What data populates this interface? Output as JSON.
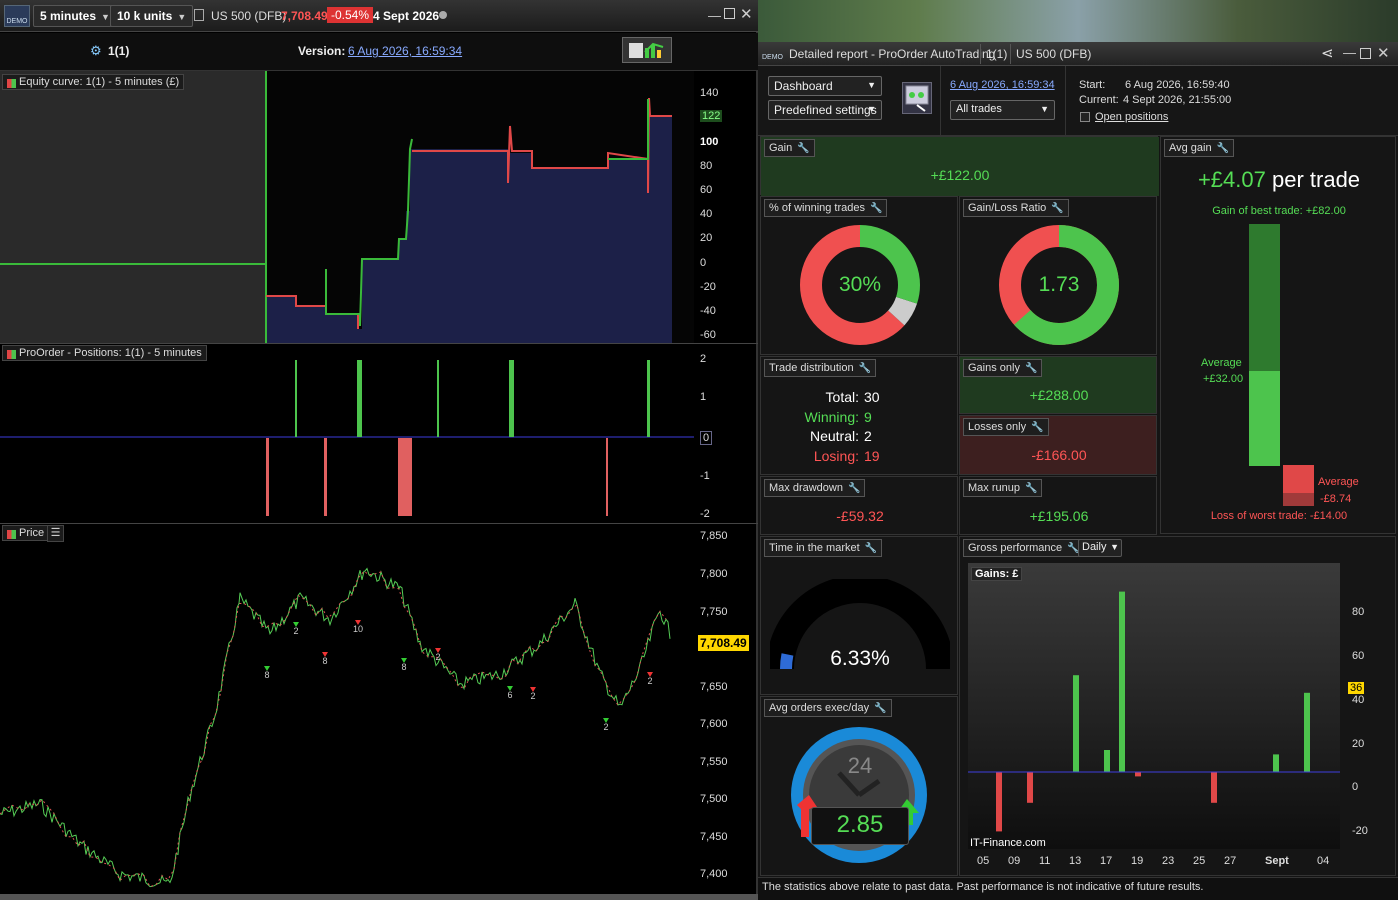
{
  "toolbar": {
    "timeframe": "5 minutes",
    "units": "10 k units",
    "instrument": "US 500 (DFB)",
    "price": "7,708.49",
    "change": "-0.54%",
    "date": "4 Sept 2026"
  },
  "strategy": {
    "name": "1(1)",
    "version_label": "Version:",
    "version_date": "6 Aug 2026, 16:59:34"
  },
  "panels": {
    "equity": {
      "label": "Equity curve: 1(1) - 5 minutes (£)",
      "ticks": [
        "140",
        "122",
        "100",
        "80",
        "60",
        "40",
        "20",
        "0",
        "-20",
        "-40",
        "-60"
      ]
    },
    "positions": {
      "label": "ProOrder - Positions: 1(1) - 5 minutes",
      "ticks": [
        "2",
        "1",
        "0",
        "-1",
        "-2"
      ]
    },
    "price": {
      "label": "Price",
      "ticks": [
        "7,850",
        "7,800",
        "7,750",
        "7,708.49",
        "7,650",
        "7,600",
        "7,550",
        "7,500",
        "7,450",
        "7,400"
      ],
      "markers": [
        "8",
        "8",
        "2",
        "10",
        "8",
        "2",
        "6",
        "2",
        "2",
        "2"
      ]
    }
  },
  "report": {
    "title": "Detailed report - ProOrder AutoTrading",
    "strategy": "1(1)",
    "instrument": "US 500 (DFB)",
    "dashboard": "Dashboard",
    "predefined": "Predefined settings",
    "date_link": "6 Aug 2026, 16:59:34",
    "trades_filter": "All trades",
    "start_label": "Start:",
    "start": "6 Aug 2026, 16:59:40",
    "current_label": "Current:",
    "current": "4 Sept 2026, 21:55:00",
    "open_positions": "Open positions",
    "gain": {
      "title": "Gain",
      "value": "+£122.00"
    },
    "winning": {
      "title": "% of winning trades",
      "value": "30%",
      "win_pct": 30,
      "neutral_pct": 6.67,
      "lose_pct": 63.33
    },
    "gl_ratio": {
      "title": "Gain/Loss Ratio",
      "value": "1.73",
      "ratio": 1.73
    },
    "avg_gain": {
      "title": "Avg gain",
      "value": "+£4.07",
      "unit": "per trade",
      "best": "Gain of best trade: +£82.00",
      "avg_win_label": "Average",
      "avg_win": "+£32.00",
      "avg_loss_label": "Average",
      "avg_loss": "-£8.74",
      "worst": "Loss of worst trade: -£14.00"
    },
    "distribution": {
      "title": "Trade distribution",
      "total_label": "Total:",
      "total": "30",
      "winning_label": "Winning:",
      "winning": "9",
      "neutral_label": "Neutral:",
      "neutral": "2",
      "losing_label": "Losing:",
      "losing": "19"
    },
    "gains_only": {
      "title": "Gains only",
      "value": "+£288.00"
    },
    "losses_only": {
      "title": "Losses only",
      "value": "-£166.00"
    },
    "max_drawdown": {
      "title": "Max drawdown",
      "value": "-£59.32"
    },
    "max_runup": {
      "title": "Max runup",
      "value": "+£195.06"
    },
    "time_market": {
      "title": "Time in the market",
      "value": "6.33%",
      "pct": 6.33
    },
    "orders": {
      "title": "Avg orders exec/day",
      "value": "2.85",
      "clock": "24"
    },
    "gross": {
      "title": "Gross performance",
      "period": "Daily",
      "axis_title": "Gains: £",
      "watermark": "IT-Finance.com",
      "badge": "36",
      "yticks": [
        "80",
        "60",
        "40",
        "20",
        "0",
        "-20"
      ],
      "xticks": [
        "05",
        "09",
        "11",
        "13",
        "17",
        "19",
        "23",
        "25",
        "27",
        "Sept",
        "04"
      ]
    },
    "disclaimer": "The statistics above relate to past data. Past performance is not indicative of future results."
  },
  "chart_data": {
    "type": "bar",
    "title": "Gross performance",
    "ylabel": "Gains: £",
    "ylim": [
      -35,
      95
    ],
    "series": [
      {
        "values": [
          -27,
          -14,
          44,
          10,
          82,
          -2,
          -14,
          8,
          36
        ]
      }
    ],
    "x": [
      "07",
      "10",
      "13",
      "16",
      "18",
      "19",
      "26",
      "03",
      "04"
    ]
  },
  "colors": {
    "win": "#4dc44d",
    "loss": "#e04848",
    "accent": "#ffd700"
  }
}
